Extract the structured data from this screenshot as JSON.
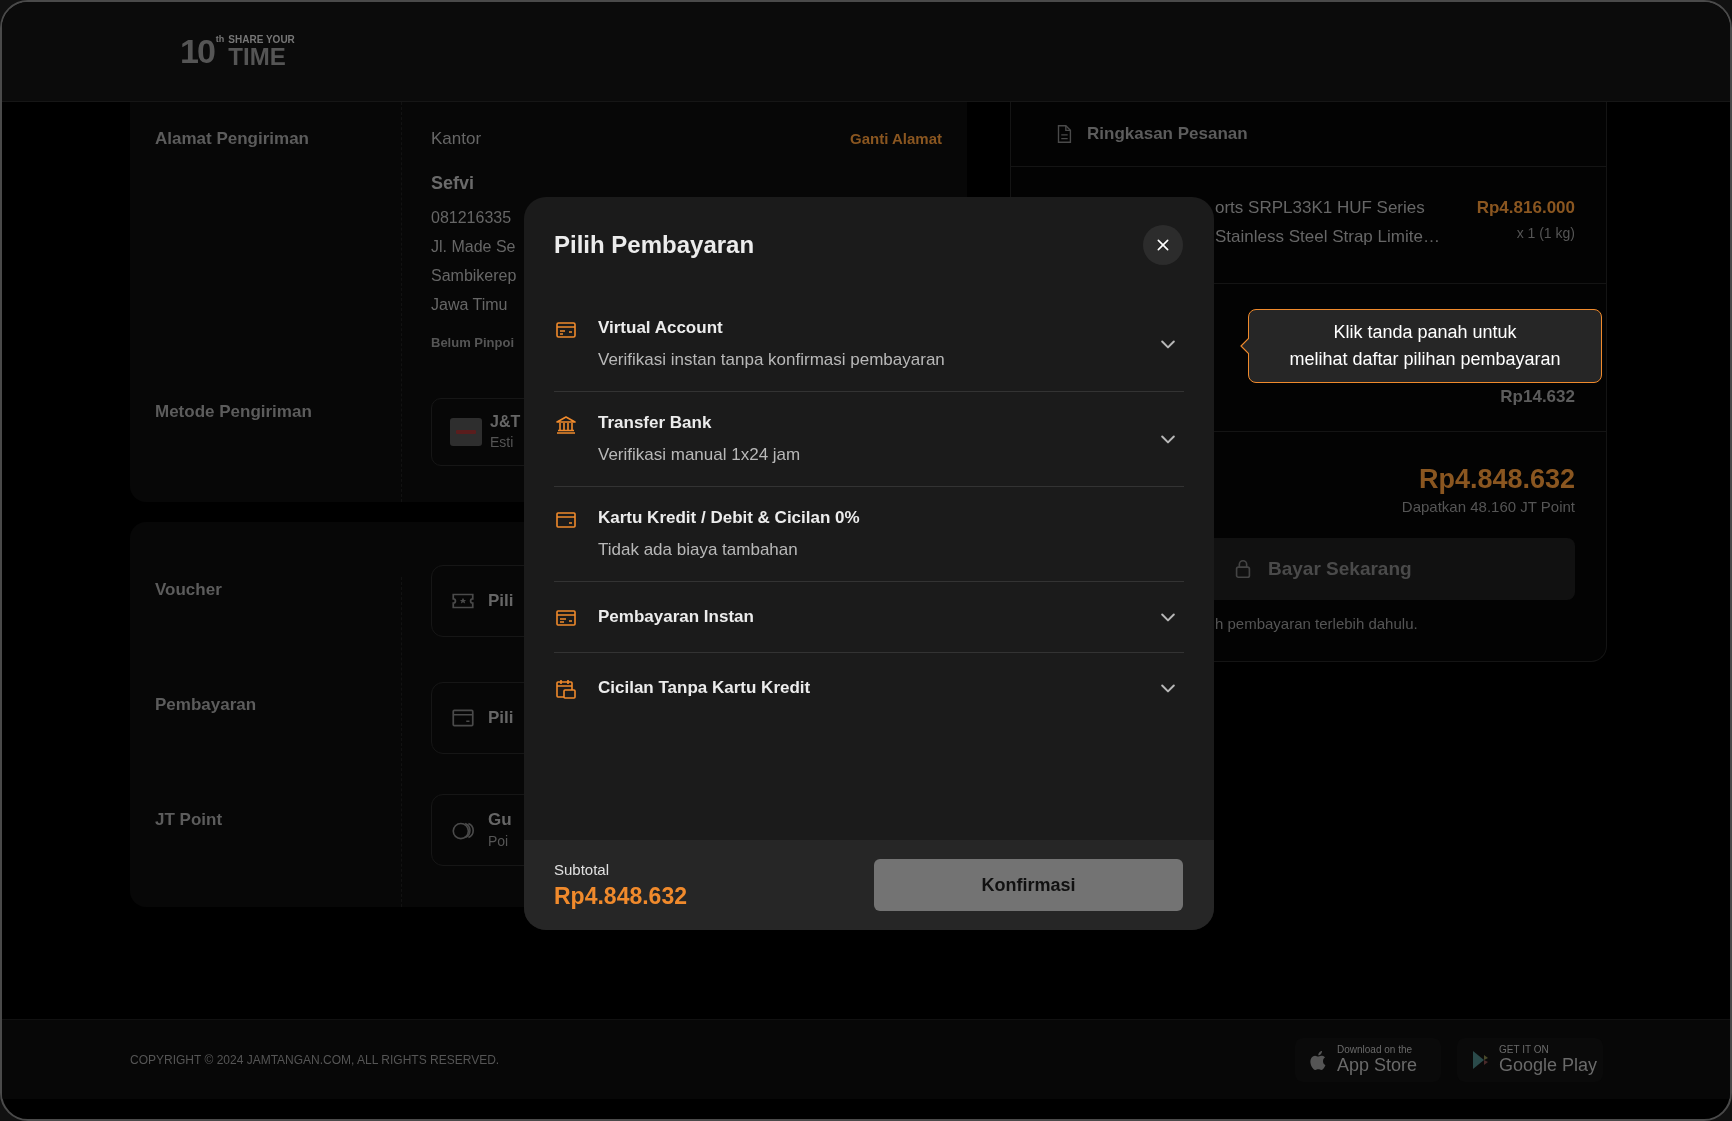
{
  "page": {
    "logo": {
      "number": "10",
      "suffix": "th",
      "tagline": "SHARE YOUR",
      "word": "TIME"
    },
    "shipping": {
      "address_label": "Alamat Pengiriman",
      "address_name": "Kantor",
      "change_link": "Ganti Alamat",
      "recipient": "Sefvi",
      "lines": [
        "081216335",
        "Jl. Made Se",
        "Sambikerep",
        "Jawa Timu"
      ],
      "pinpoint": "Belum Pinpoi",
      "method_label": "Metode Pengiriman",
      "courier": {
        "name": "J&T",
        "sub": "Esti"
      }
    },
    "extras": [
      {
        "kind": "voucher",
        "label": "Voucher",
        "value": "Pili"
      },
      {
        "kind": "payment",
        "label": "Pembayaran",
        "value": "Pili"
      },
      {
        "kind": "points",
        "label": "JT Point",
        "value": "Gu",
        "sub": "Poi"
      }
    ],
    "summary": {
      "title": "Ringkasan Pesanan",
      "product_lines": [
        "orts SRPL33K1 HUF Series",
        "Stainless Steel Strap Limite…"
      ],
      "price": "Rp4.816.000",
      "qty": "x 1 (1 kg)",
      "fee": "Rp14.632",
      "total": "Rp4.848.632",
      "points": "Dapatkan 48.160 JT Point",
      "pay_button": "Bayar Sekarang",
      "note": "h pembayaran terlebih dahulu."
    },
    "footer": {
      "copyright": "COPYRIGHT © 2024 JAMTANGAN.COM, ALL RIGHTS RESERVED.",
      "badges": [
        {
          "kind": "apple",
          "small": "Download on the",
          "big": "App Store"
        },
        {
          "kind": "google",
          "small": "GET IT ON",
          "big": "Google Play"
        }
      ]
    }
  },
  "tooltip": {
    "lines": [
      "Klik tanda panah untuk",
      "melihat daftar pilihan pembayaran"
    ]
  },
  "modal": {
    "title": "Pilih Pembayaran",
    "options": [
      {
        "kind": "wallet",
        "title": "Virtual Account",
        "subtitle": "Verifikasi instan tanpa konfirmasi pembayaran",
        "expandable": true
      },
      {
        "kind": "bank",
        "title": "Transfer Bank",
        "subtitle": "Verifikasi manual 1x24 jam",
        "expandable": true
      },
      {
        "kind": "card",
        "title": "Kartu Kredit / Debit & Cicilan 0%",
        "subtitle": "Tidak ada biaya tambahan",
        "expandable": false
      },
      {
        "kind": "instant",
        "title": "Pembayaran Instan",
        "expandable": true
      },
      {
        "kind": "calendar",
        "title": "Cicilan Tanpa Kartu Kredit",
        "expandable": true
      }
    ],
    "subtotal_label": "Subtotal",
    "subtotal": "Rp4.848.632",
    "confirm": {
      "label": "Konfirmasi",
      "disabled": true
    }
  }
}
